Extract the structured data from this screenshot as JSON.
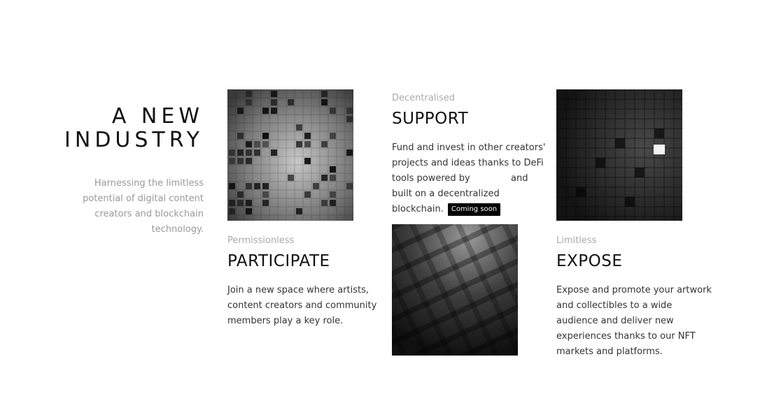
{
  "intro": {
    "title_line1": "A NEW",
    "title_line2": "INDUSTRY",
    "description": "Harnessing the limitless potential of digital content creators and blockchain technology."
  },
  "support": {
    "kicker": "Decentralised",
    "title": "SUPPORT",
    "text_before": "Fund and invest in other creators' projects and ideas thanks to DeFi tools powered by",
    "text_after": "and built on a decentralized blockchain.",
    "badge": "Coming soon"
  },
  "participate": {
    "kicker": "Permissionless",
    "title": "PARTICIPATE",
    "text": "Join a new space where artists, content creators and community members play a key role."
  },
  "expose": {
    "kicker": "Limitless",
    "title": "EXPOSE",
    "text": "Expose and promote your artwork and collectibles to a wide audience and deliver new experiences thanks to our NFT markets and platforms."
  }
}
